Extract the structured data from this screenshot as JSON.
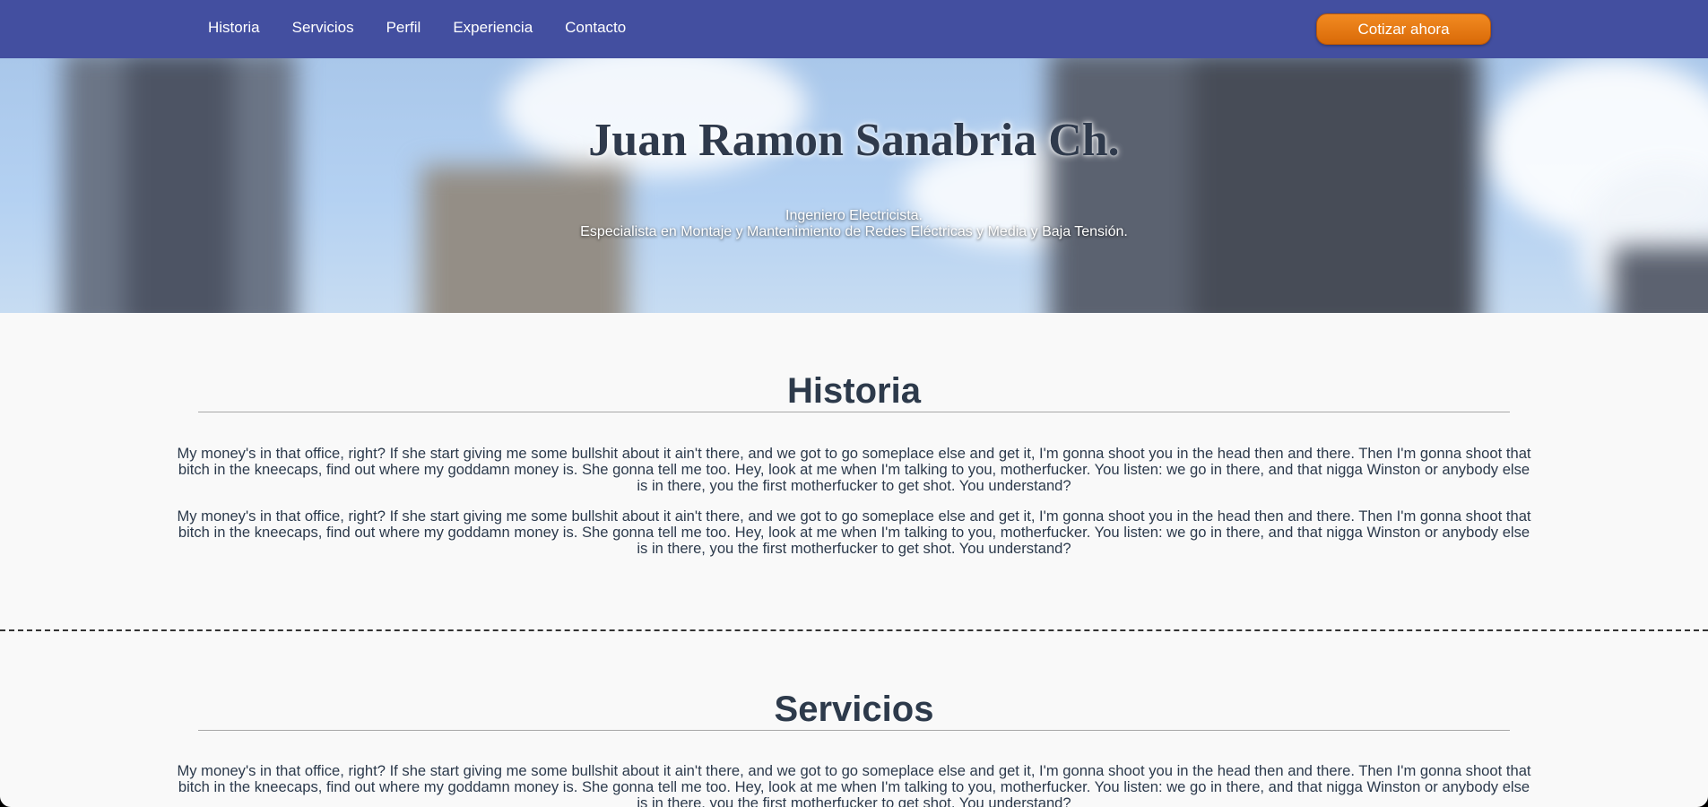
{
  "nav": {
    "items": [
      {
        "label": "Historia"
      },
      {
        "label": "Servicios"
      },
      {
        "label": "Perfil"
      },
      {
        "label": "Experiencia"
      },
      {
        "label": "Contacto"
      }
    ],
    "cta_label": "Cotizar ahora"
  },
  "hero": {
    "title": "Juan Ramon Sanabria Ch.",
    "subtitle_line1": "Ingeniero Electricista.",
    "subtitle_line2": "Especialista en Montaje y Mantenimiento de Redes Eléctricas y Media y Baja Tensión."
  },
  "sections": [
    {
      "title": "Historia",
      "paragraphs": [
        "My money's in that office, right? If she start giving me some bullshit about it ain't there, and we got to go someplace else and get it, I'm gonna shoot you in the head then and there. Then I'm gonna shoot that bitch in the kneecaps, find out where my goddamn money is. She gonna tell me too. Hey, look at me when I'm talking to you, motherfucker. You listen: we go in there, and that nigga Winston or anybody else is in there, you the first motherfucker to get shot. You understand?",
        "My money's in that office, right? If she start giving me some bullshit about it ain't there, and we got to go someplace else and get it, I'm gonna shoot you in the head then and there. Then I'm gonna shoot that bitch in the kneecaps, find out where my goddamn money is. She gonna tell me too. Hey, look at me when I'm talking to you, motherfucker. You listen: we go in there, and that nigga Winston or anybody else is in there, you the first motherfucker to get shot. You understand?"
      ]
    },
    {
      "title": "Servicios",
      "paragraphs": [
        "My money's in that office, right? If she start giving me some bullshit about it ain't there, and we got to go someplace else and get it, I'm gonna shoot you in the head then and there. Then I'm gonna shoot that bitch in the kneecaps, find out where my goddamn money is. She gonna tell me too. Hey, look at me when I'm talking to you, motherfucker. You listen: we go in there, and that nigga Winston or anybody else is in there, you the first motherfucker to get shot. You understand?"
      ]
    }
  ],
  "colors": {
    "nav_bg": "#434fa0",
    "cta_orange": "#e97d17",
    "heading_text": "#2d3a4b",
    "page_bg": "#f9f9f9"
  }
}
